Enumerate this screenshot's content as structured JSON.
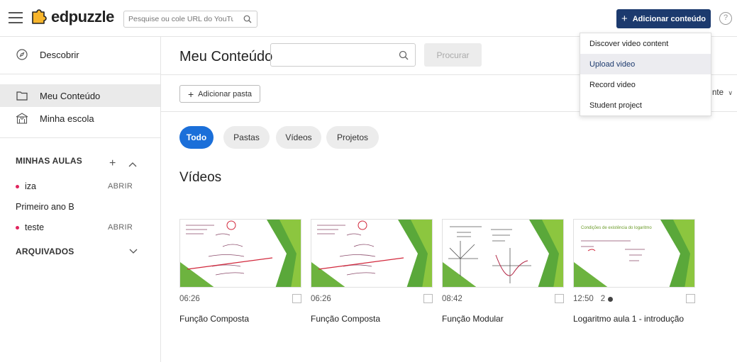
{
  "app": {
    "name": "edpuzzle"
  },
  "topbar": {
    "search_placeholder": "Pesquise ou cole URL do YouTube",
    "add_button_label": "Adicionar conteúdo",
    "help_label": "?"
  },
  "sidebar": {
    "discover_label": "Descobrir",
    "my_content_label": "Meu Conteúdo",
    "school_label": "Minha escola",
    "classes_heading": "MINHAS AULAS",
    "classes": [
      {
        "name": "iza",
        "action": "ABRIR"
      },
      {
        "group": "Primeiro ano B"
      },
      {
        "name": "teste",
        "action": "ABRIR"
      }
    ],
    "archived_heading": "ARQUIVADOS"
  },
  "main": {
    "title": "Meu Conteúdo",
    "search_value": "",
    "search_button": "Procurar",
    "add_folder_label": "Adicionar pasta",
    "sort_peek": "nte",
    "filters": [
      "Todo",
      "Pastas",
      "Vídeos",
      "Projetos"
    ],
    "active_filter": "Todo",
    "videos_heading": "Vídeos",
    "videos": [
      {
        "duration": "06:26",
        "title": "Função Composta",
        "views": ""
      },
      {
        "duration": "06:26",
        "title": "Função Composta",
        "views": ""
      },
      {
        "duration": "08:42",
        "title": "Função Modular",
        "views": ""
      },
      {
        "duration": "12:50",
        "title": "Logaritmo aula 1 - introdução",
        "views": "2"
      }
    ],
    "thumb_caption_4": "Condições de existência do logaritmo"
  },
  "dropdown": {
    "items": [
      "Discover video content",
      "Upload video",
      "Record video",
      "Student project"
    ],
    "highlighted": "Upload video"
  },
  "colors": {
    "primary": "#1c3a6e",
    "filter_active": "#1b6fd9",
    "class_dot": "#e0245e",
    "logo_yellow": "#f7b52c"
  }
}
